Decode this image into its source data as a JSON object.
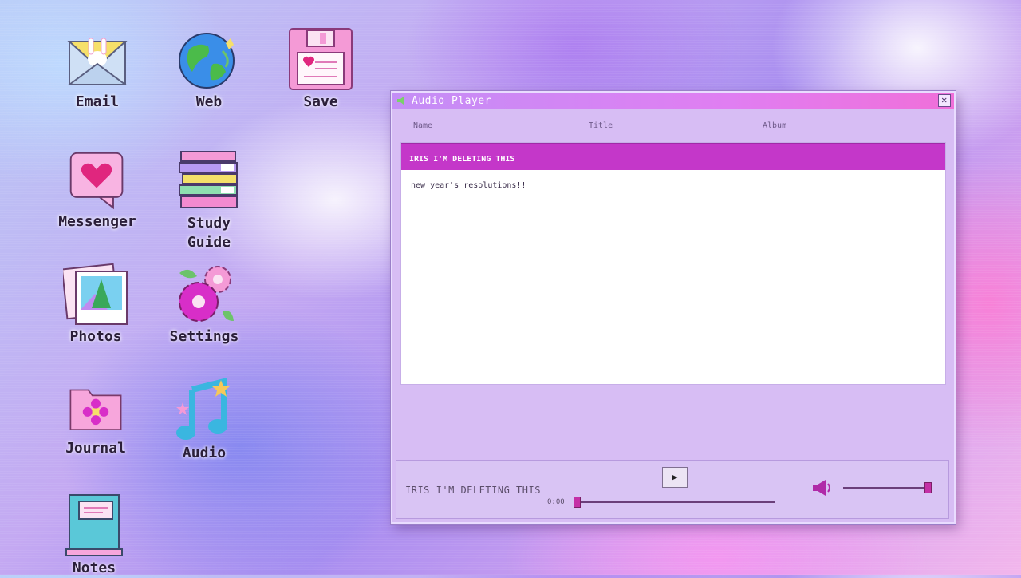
{
  "desktop": {
    "icons": [
      {
        "id": "email",
        "label": "Email"
      },
      {
        "id": "web",
        "label": "Web"
      },
      {
        "id": "save",
        "label": "Save"
      },
      {
        "id": "messenger",
        "label": "Messenger"
      },
      {
        "id": "study",
        "label": "Study\nGuide"
      },
      {
        "id": "photos",
        "label": "Photos"
      },
      {
        "id": "settings",
        "label": "Settings"
      },
      {
        "id": "journal",
        "label": "Journal"
      },
      {
        "id": "audio",
        "label": "Audio"
      },
      {
        "id": "notes",
        "label": "Notes"
      }
    ]
  },
  "player": {
    "title": "Audio Player",
    "close_symbol": "✕",
    "columns": {
      "name": "Name",
      "title": "Title",
      "album": "Album"
    },
    "selected_track": "IRIS I'M DELETING THIS",
    "track_note": "new year's resolutions!!",
    "now_playing": "IRIS I'M DELETING THIS",
    "play_symbol": "▶",
    "elapsed": "0:00",
    "progress_fraction": 0.0,
    "volume_fraction": 0.95
  },
  "colors": {
    "accent": "#c437c9",
    "titlebar": "#e07ef2",
    "window_bg": "#d7bdf4"
  }
}
